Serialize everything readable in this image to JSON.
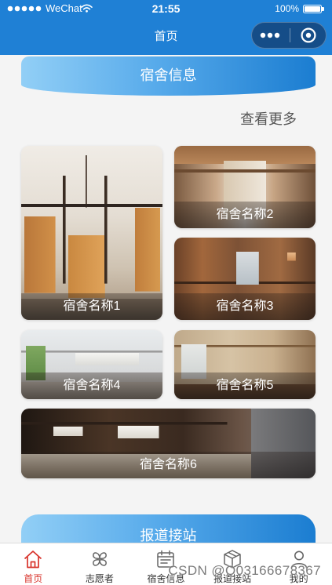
{
  "colors": {
    "header_blue": "#1f80d5",
    "page_bg": "#f4f4f4",
    "banner_light": "#92cff6",
    "banner_dark": "#1b7dd1",
    "tab_active": "#d8332b",
    "tab_inactive": "#666666",
    "more_link": "#555555"
  },
  "status_bar": {
    "signal_strength": 5,
    "carrier": "WeChat",
    "wifi_icon": "wifi-icon",
    "time": "21:55",
    "battery_text": "100%",
    "battery_level": 1
  },
  "nav": {
    "title": "首页",
    "capsule": {
      "more_icon": "more-dots-icon",
      "close_icon": "target-ring-icon"
    }
  },
  "dorm_section": {
    "title": "宿舍信息",
    "more_link": "查看更多",
    "cards": [
      {
        "label": "宿舍名称1"
      },
      {
        "label": "宿舍名称2"
      },
      {
        "label": "宿舍名称3"
      },
      {
        "label": "宿舍名称4"
      },
      {
        "label": "宿舍名称5"
      },
      {
        "label": "宿舍名称6"
      }
    ]
  },
  "pickup_section": {
    "title": "报道接站"
  },
  "tab_bar": {
    "items": [
      {
        "label": "首页",
        "icon": "home-icon",
        "active": true
      },
      {
        "label": "志愿者",
        "icon": "clover-icon",
        "active": false
      },
      {
        "label": "宿舍信息",
        "icon": "calendar-icon",
        "active": false
      },
      {
        "label": "报道接站",
        "icon": "box-icon",
        "active": false
      },
      {
        "label": "我的",
        "icon": "person-icon",
        "active": false
      }
    ]
  },
  "watermark": "CSDN @Q03166678367"
}
